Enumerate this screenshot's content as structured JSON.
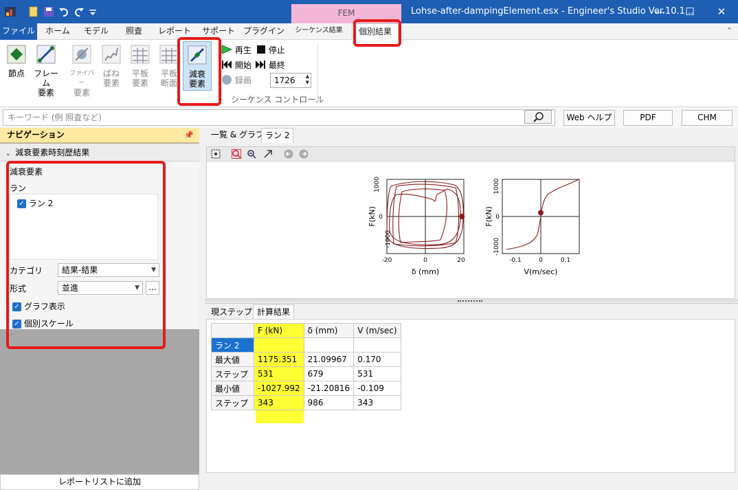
{
  "window": {
    "context_tab": "FEM",
    "title": "Lohse-after-dampingElement.esx - Engineer's Studio Ver.10.1...",
    "minimize": "—",
    "maximize": "☐",
    "close": "✕"
  },
  "ribbon_tabs": [
    "ファイル",
    "ホーム",
    "モデル",
    "照査",
    "レポート",
    "サポート",
    "プラグイン",
    "シーケンス結果",
    "個別結果"
  ],
  "ribbon": {
    "buttons": [
      {
        "line1": "節点",
        "line2": ""
      },
      {
        "line1": "フレーム",
        "line2": "要素"
      },
      {
        "line1": "ファイバー",
        "line2": "要素"
      },
      {
        "line1": "ばね",
        "line2": "要素"
      },
      {
        "line1": "平板",
        "line2": "要素"
      },
      {
        "line1": "平板",
        "line2": "断面"
      },
      {
        "line1": "減衰",
        "line2": "要素"
      }
    ],
    "play": "再生",
    "stop": "停止",
    "start": "開始",
    "end": "最終",
    "record": "録画",
    "step_value": "1726",
    "group_label": "シーケンス コントロール"
  },
  "search": {
    "placeholder": "キーワード (例 照査など)",
    "web_help": "Web ヘルプ",
    "pdf": "PDF",
    "chm": "CHM"
  },
  "nav": {
    "title": "ナビゲーション",
    "section": "減衰要素時刻歴結果",
    "element_label": "減衰要素",
    "run_label": "ラン",
    "runs": [
      "ラン 2"
    ],
    "category_label": "カテゴリ",
    "category_value": "結果-結果",
    "format_label": "形式",
    "format_value": "並進",
    "dots": "...",
    "graph_display": "グラフ表示",
    "individual_scale": "個別スケール",
    "report_button": "レポートリストに追加"
  },
  "content": {
    "tabs": [
      "一覧 & グラフ",
      "ラン 2"
    ],
    "bottom_tabs": [
      "現ステップ",
      "計算結果"
    ]
  },
  "charts": [
    {
      "type": "line",
      "xlabel": "δ (mm)",
      "ylabel": "F(kN)",
      "xlim": [
        -20,
        20
      ],
      "ylim": [
        -1000,
        1000
      ],
      "xticks": [
        "-20",
        "0",
        "20"
      ],
      "yticks": [
        "1000",
        "0",
        "-1000"
      ],
      "current_point": {
        "x": 19,
        "y": 0
      },
      "line_color": "#8b1a1a"
    },
    {
      "type": "line",
      "xlabel": "V(m/sec)",
      "ylabel": "F(kN)",
      "xlim": [
        -0.15,
        0.15
      ],
      "ylim": [
        -1000,
        1000
      ],
      "xticks": [
        "-0.1",
        "0",
        "0.1"
      ],
      "yticks": [
        "1000",
        "0",
        "-1000"
      ],
      "current_point": {
        "x": 0,
        "y": 100
      },
      "line_color": "#8b1a1a"
    }
  ],
  "table": {
    "headers": [
      "",
      "F (kN)",
      "δ (mm)",
      "V (m/sec)"
    ],
    "rows": [
      [
        "ラン 2",
        "",
        "",
        ""
      ],
      [
        "最大値",
        "1175.351",
        "21.09967",
        "0.170"
      ],
      [
        "ステップ",
        "531",
        "679",
        "531"
      ],
      [
        "最小値",
        "-1027.992",
        "-21.20816",
        "-0.109"
      ],
      [
        "ステップ",
        "343",
        "986",
        "343"
      ]
    ]
  }
}
